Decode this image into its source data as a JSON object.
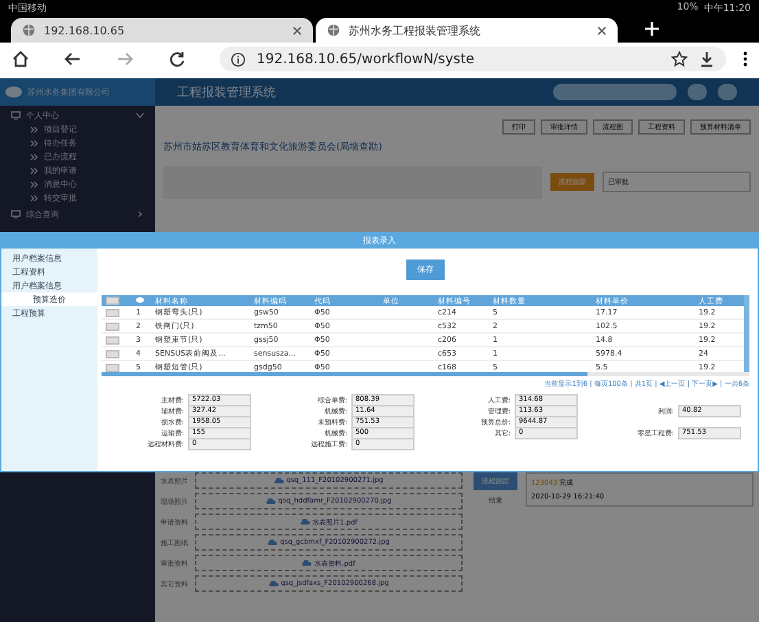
{
  "status_bar": {
    "carrier": "中国移动",
    "battery": "10%",
    "time": "中午11:20"
  },
  "browser_tabs": [
    {
      "title": "192.168.10.65",
      "selected": false
    },
    {
      "title": "苏州水务工程报装管理系统",
      "selected": true
    }
  ],
  "address": "192.168.10.65/workflowN/syste",
  "app": {
    "company": "苏州水务集团有限公司",
    "title": "工程报装管理系统"
  },
  "sidebar": [
    {
      "label": "个人中心",
      "expanded": true,
      "children": [
        {
          "label": "项目登记"
        },
        {
          "label": "待办任务"
        },
        {
          "label": "已办流程"
        },
        {
          "label": "我的申请"
        },
        {
          "label": "消息中心"
        },
        {
          "label": "转交审批"
        }
      ]
    },
    {
      "label": "综合查询",
      "expanded": false
    }
  ],
  "actions": [
    "打印",
    "审批详情",
    "流程图",
    "工程资料",
    "预算材料清单"
  ],
  "project_title": "苏州市姑苏区教育体育和文化旅游委员会(局墙查勘)",
  "process": {
    "button": "流程跟踪",
    "status": "已审批"
  },
  "attachments": [
    {
      "label": "水表照片",
      "file": "qsq_111_F20102900271.jpg"
    },
    {
      "label": "现场照片",
      "file": "qsq_hddfamr_F20102900270.jpg"
    },
    {
      "label": "申请资料",
      "file": "水表照片1.pdf"
    },
    {
      "label": "施工图纸",
      "file": "qsq_gcbmxf_F20102900272.jpg"
    },
    {
      "label": "审批资料",
      "file": "水表资料.pdf"
    },
    {
      "label": "其它资料",
      "file": "qsq_jsdfaxs_F20102900268.jpg"
    }
  ],
  "timeline": {
    "button": "流程跟踪",
    "end": "结束",
    "node": "123043",
    "state": "完成",
    "time": "2020-10-29 16:21:40"
  },
  "dialog": {
    "title": "报表录入",
    "nav": [
      {
        "label": "用户档案信息",
        "selected": false
      },
      {
        "label": "工程资料",
        "selected": false
      },
      {
        "label": "用户档案信息",
        "selected": false
      },
      {
        "label": "预算造价",
        "selected": true
      },
      {
        "label": "工程预算",
        "selected": false
      }
    ],
    "save": "保存",
    "all_checked": false,
    "columns": [
      "材料名称",
      "材料编码",
      "代码",
      "单位",
      "材料编号",
      "材料数量",
      "材料单价",
      "人工费"
    ],
    "rows": [
      {
        "no": "1",
        "cells": [
          "钢塑弯头(只)",
          "gsw50",
          "Φ50",
          "",
          "c214",
          "5",
          "17.17",
          "19.2"
        ],
        "checked": false
      },
      {
        "no": "2",
        "cells": [
          "铁闸门(只)",
          "tzm50",
          "Φ50",
          "",
          "c532",
          "2",
          "102.5",
          "19.2"
        ],
        "checked": false
      },
      {
        "no": "3",
        "cells": [
          "钢塑束节(只)",
          "gssj50",
          "Φ50",
          "",
          "c206",
          "1",
          "14.8",
          "19.2"
        ],
        "checked": false
      },
      {
        "no": "4",
        "cells": [
          "SENSUS表前阀及...",
          "sensusza...",
          "Φ50",
          "",
          "c653",
          "1",
          "5978.4",
          "24"
        ],
        "checked": false
      },
      {
        "no": "5",
        "cells": [
          "钢塑短管(只)",
          "gsdg50",
          "Φ50",
          "",
          "c168",
          "5",
          "5.5",
          "19.2"
        ],
        "checked": false
      }
    ],
    "pager": "当前显示1到6 | 每页100条 | 共1页 | ◀上一页 | 下一页▶ | 一共6条",
    "summary": [
      [
        {
          "label": "主材费:",
          "value": "5722.03"
        },
        {
          "label": "辅材费:",
          "value": "327.42"
        },
        {
          "label": "损水费:",
          "value": "1958.05"
        },
        {
          "label": "运输费:",
          "value": "155"
        },
        {
          "label": "远程材料费:",
          "value": "0"
        }
      ],
      [
        {
          "label": "综合单费:",
          "value": "808.39"
        },
        {
          "label": "机械费:",
          "value": "11.64"
        },
        {
          "label": "未预料费:",
          "value": "751.53"
        },
        {
          "label": "机械费:",
          "value": "500"
        },
        {
          "label": "远程施工费:",
          "value": "0"
        }
      ],
      [
        {
          "label": "人工费:",
          "value": "314.68"
        },
        {
          "label": "管理费:",
          "value": "113.63"
        },
        {
          "label": "预算总价:",
          "value": "9644.87"
        },
        {
          "label": "其它:",
          "value": "0"
        }
      ]
    ],
    "summary_side": [
      {
        "label": "利润:",
        "value": "40.82"
      },
      {
        "label": "零星工程费:",
        "value": "751.53"
      }
    ]
  }
}
